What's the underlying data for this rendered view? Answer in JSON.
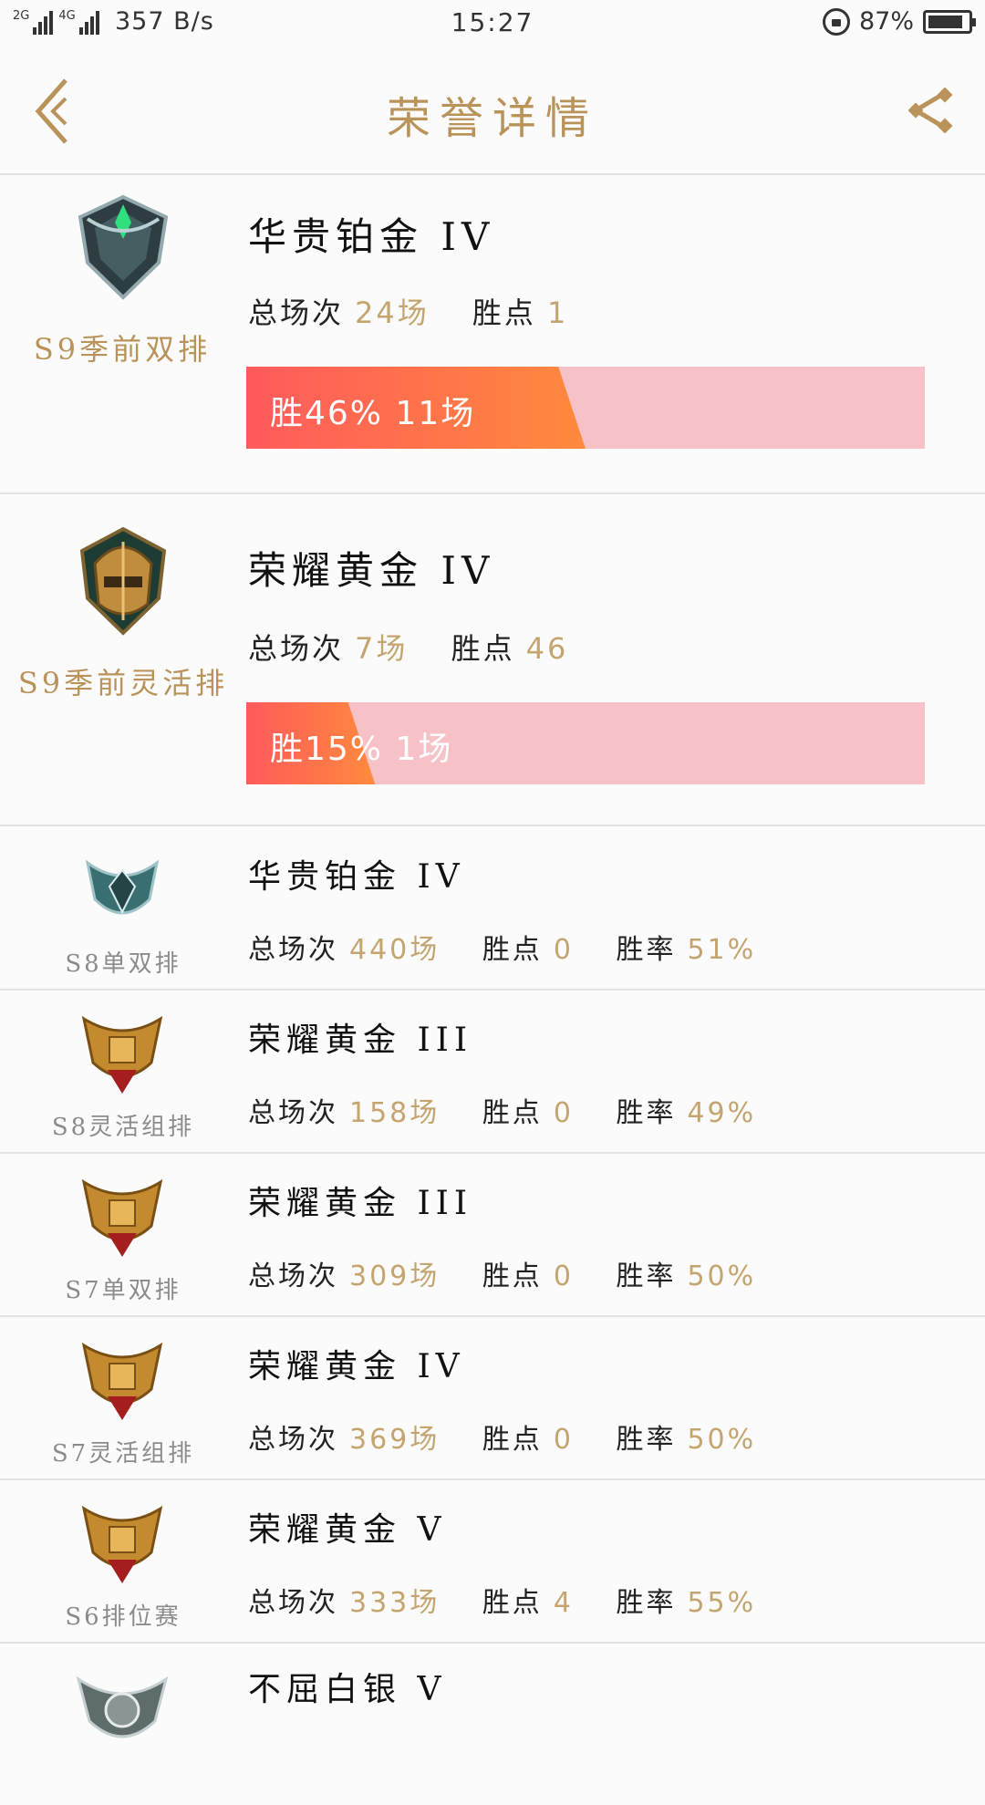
{
  "status_bar": {
    "network_2g": "2G",
    "network_4g": "4G",
    "speed": "357 B/s",
    "time": "15:27",
    "battery_pct": "87%",
    "battery_level": 0.87
  },
  "nav": {
    "title": "荣誉详情",
    "back_icon": "chevron-left-icon",
    "share_icon": "share-icon"
  },
  "labels": {
    "total": "总场次",
    "points": "胜点",
    "rate": "胜率"
  },
  "colors": {
    "accent_gold": "#b9935a",
    "value_gold": "#c5a56f",
    "bar_bg": "#f7c2c7",
    "bar_fill": "#ff6a4a"
  },
  "featured": [
    {
      "season": "S9季前双排",
      "rank": "华贵铂金 IV",
      "total": "24场",
      "points": "1",
      "win_text": "胜46% 11场",
      "win_fraction": 0.46,
      "emblem": "platinum-emblem-icon"
    },
    {
      "season": "S9季前灵活排",
      "rank": "荣耀黄金 IV",
      "total": "7场",
      "points": "46",
      "win_text": "胜15% 1场",
      "win_fraction": 0.15,
      "emblem": "gold-emblem-icon"
    }
  ],
  "history": [
    {
      "season": "S8单双排",
      "rank": "华贵铂金 IV",
      "total": "440场",
      "points": "0",
      "rate": "51%",
      "emblem": "platinum-emblem-icon"
    },
    {
      "season": "S8灵活组排",
      "rank": "荣耀黄金 III",
      "total": "158场",
      "points": "0",
      "rate": "49%",
      "emblem": "gold-emblem-icon"
    },
    {
      "season": "S7单双排",
      "rank": "荣耀黄金 III",
      "total": "309场",
      "points": "0",
      "rate": "50%",
      "emblem": "gold-emblem-icon"
    },
    {
      "season": "S7灵活组排",
      "rank": "荣耀黄金 IV",
      "total": "369场",
      "points": "0",
      "rate": "50%",
      "emblem": "gold-emblem-icon"
    },
    {
      "season": "S6排位赛",
      "rank": "荣耀黄金 V",
      "total": "333场",
      "points": "4",
      "rate": "55%",
      "emblem": "gold-emblem-icon"
    },
    {
      "season": "",
      "rank": "不屈白银 V",
      "total": "",
      "points": "",
      "rate": "",
      "emblem": "silver-emblem-icon"
    }
  ]
}
